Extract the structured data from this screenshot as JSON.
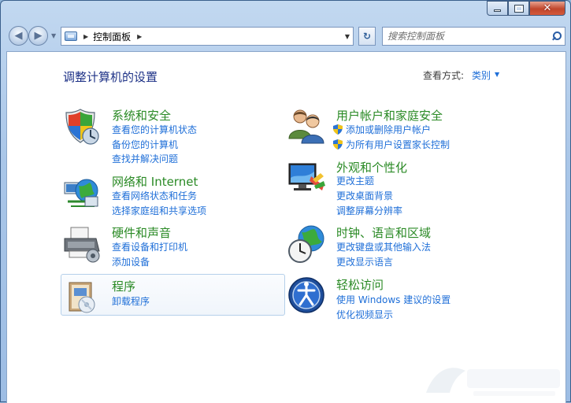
{
  "window": {
    "caption_close": "✕"
  },
  "nav": {
    "address_text": "控制面板",
    "search_placeholder": "搜索控制面板"
  },
  "header": {
    "title": "调整计算机的设置",
    "view_by_label": "查看方式:",
    "view_by_value": "类别"
  },
  "categories": [
    {
      "title": "系统和安全",
      "links": [
        "查看您的计算机状态",
        "备份您的计算机",
        "查找并解决问题"
      ],
      "icon": "shield-icon"
    },
    {
      "title": "网络和 Internet",
      "links": [
        "查看网络状态和任务",
        "选择家庭组和共享选项"
      ],
      "icon": "network-globe-icon"
    },
    {
      "title": "硬件和声音",
      "links": [
        "查看设备和打印机",
        "添加设备"
      ],
      "icon": "printer-icon"
    },
    {
      "title": "程序",
      "links": [
        "卸载程序"
      ],
      "icon": "programs-icon"
    },
    {
      "title": "用户帐户和家庭安全",
      "links": [
        "添加或删除用户帐户",
        "为所有用户设置家长控制"
      ],
      "icon": "users-icon"
    },
    {
      "title": "外观和个性化",
      "links": [
        "更改主题",
        "更改桌面背景",
        "调整屏幕分辨率"
      ],
      "icon": "monitor-icon"
    },
    {
      "title": "时钟、语言和区域",
      "links": [
        "更改键盘或其他输入法",
        "更改显示语言"
      ],
      "icon": "clock-globe-icon"
    },
    {
      "title": "轻松访问",
      "links": [
        "使用 Windows 建议的设置",
        "优化视频显示"
      ],
      "icon": "ease-of-access-icon"
    }
  ],
  "colors": {
    "category_title": "#2a8a25",
    "link": "#1f6fd8",
    "page_title": "#1e3287"
  }
}
